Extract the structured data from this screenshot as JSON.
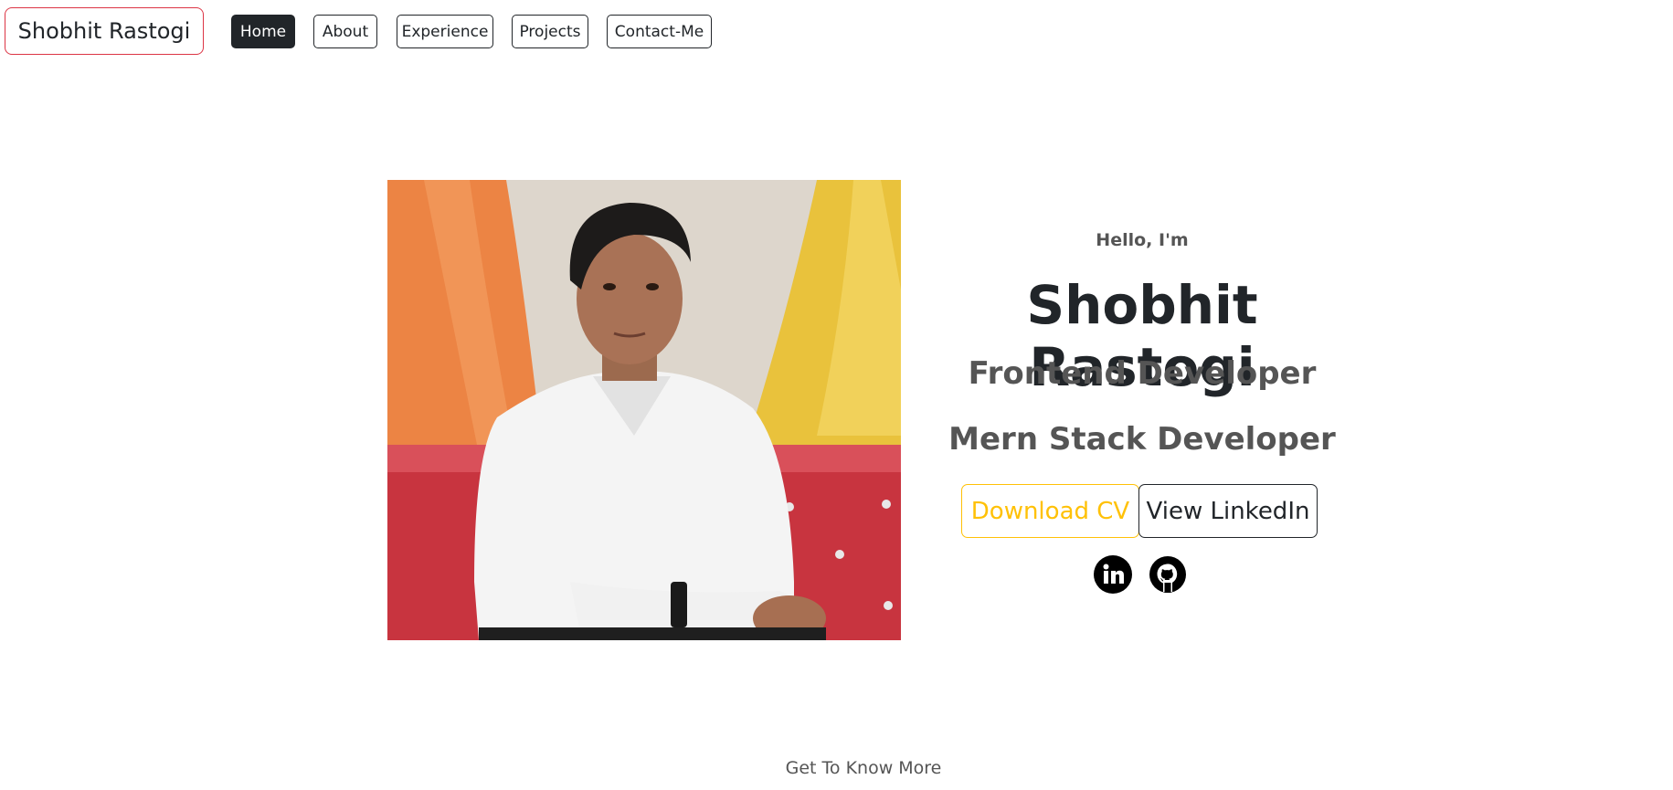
{
  "nav": {
    "brand": "Shobhit Rastogi",
    "items": [
      {
        "label": "Home",
        "active": true
      },
      {
        "label": "About"
      },
      {
        "label": "Experience"
      },
      {
        "label": "Projects"
      },
      {
        "label": "Contact-Me"
      }
    ]
  },
  "hero": {
    "greeting": "Hello, I'm",
    "name": "Shobhit Rastogi",
    "roles": [
      "Frontend Developer",
      "Mern Stack Developer"
    ],
    "buttons": {
      "download_cv": "Download CV",
      "view_linkedin": "View LinkedIn"
    },
    "social": [
      {
        "icon": "linkedin-icon"
      },
      {
        "icon": "github-icon"
      }
    ]
  },
  "footer": {
    "more": "Get To Know More"
  },
  "colors": {
    "accent": "#ffc107",
    "brand_border": "#dc3545",
    "dark": "#212529",
    "text_muted": "#555555"
  }
}
